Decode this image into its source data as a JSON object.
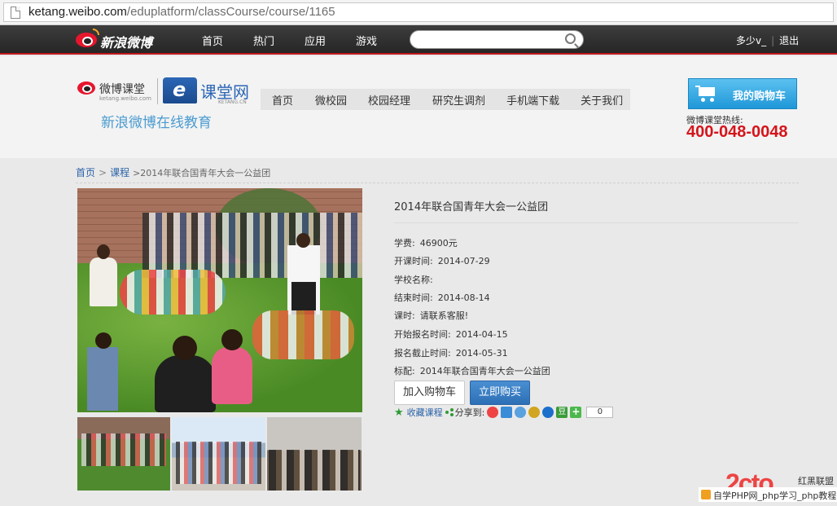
{
  "browser": {
    "url_host": "ketang.weibo.com",
    "url_path": "/eduplatform/classCourse/course/1165"
  },
  "weibo_bar": {
    "brand": "新浪微博",
    "nav": [
      "首页",
      "热门",
      "应用",
      "游戏"
    ],
    "search_placeholder": "",
    "user": "多少v_",
    "logout": "退出"
  },
  "site": {
    "logo_name": "微博课堂",
    "logo_sub": "ketang.weibo.com",
    "partner_name": "课堂网",
    "partner_sub": "KETANG.CN",
    "tagline": "新浪微博在线教育",
    "nav": [
      "首页",
      "微校园",
      "校园经理",
      "研究生调剂",
      "手机端下载",
      "关于我们"
    ],
    "cart_label": "我的购物车",
    "hotline_label": "微博课堂热线:",
    "hotline_number": "400-048-0048"
  },
  "breadcrumb": {
    "home": "首页",
    "courses": "课程",
    "current": ">2014年联合国青年大会一公益团"
  },
  "course": {
    "title": "2014年联合国青年大会一公益团",
    "fields": [
      {
        "label": "学费:",
        "value": "46900元"
      },
      {
        "label": "开课时间:",
        "value": "2014-07-29"
      },
      {
        "label": "学校名称:",
        "value": ""
      },
      {
        "label": "结束时间:",
        "value": "2014-08-14"
      },
      {
        "label": "课时:",
        "value": "请联系客服!"
      },
      {
        "label": "开始报名时间:",
        "value": "2014-04-15"
      },
      {
        "label": "报名截止时间:",
        "value": "2014-05-31"
      },
      {
        "label": "标配:",
        "value": "2014年联合国青年大会一公益团"
      }
    ],
    "add_to_cart": "加入购物车",
    "buy_now": "立即购买",
    "favorite": "收藏课程",
    "share_to": "分享到:",
    "share_douban": "豆",
    "share_more": "+",
    "share_count": "0"
  },
  "watermark": {
    "logo": "2cto",
    "side_text": "红黑联盟",
    "bar_text": "自学PHP网_php学习_php教程"
  }
}
